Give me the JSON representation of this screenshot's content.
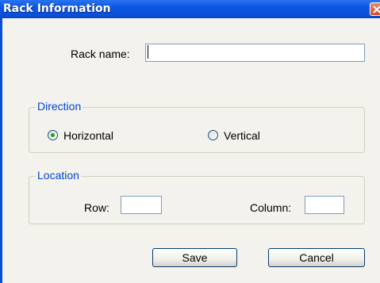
{
  "window": {
    "title": "Rack Information"
  },
  "rack_name": {
    "label": "Rack name:",
    "value": ""
  },
  "direction": {
    "legend": "Direction",
    "options": [
      "Horizontal",
      "Vertical"
    ],
    "selected": "Horizontal"
  },
  "location": {
    "legend": "Location",
    "row_label": "Row:",
    "row_value": "",
    "column_label": "Column:",
    "column_value": ""
  },
  "buttons": {
    "save": "Save",
    "cancel": "Cancel"
  },
  "colors": {
    "title_bar": "#0a57e5",
    "group_legend": "#0046d5",
    "radio_selected": "#21a121"
  }
}
